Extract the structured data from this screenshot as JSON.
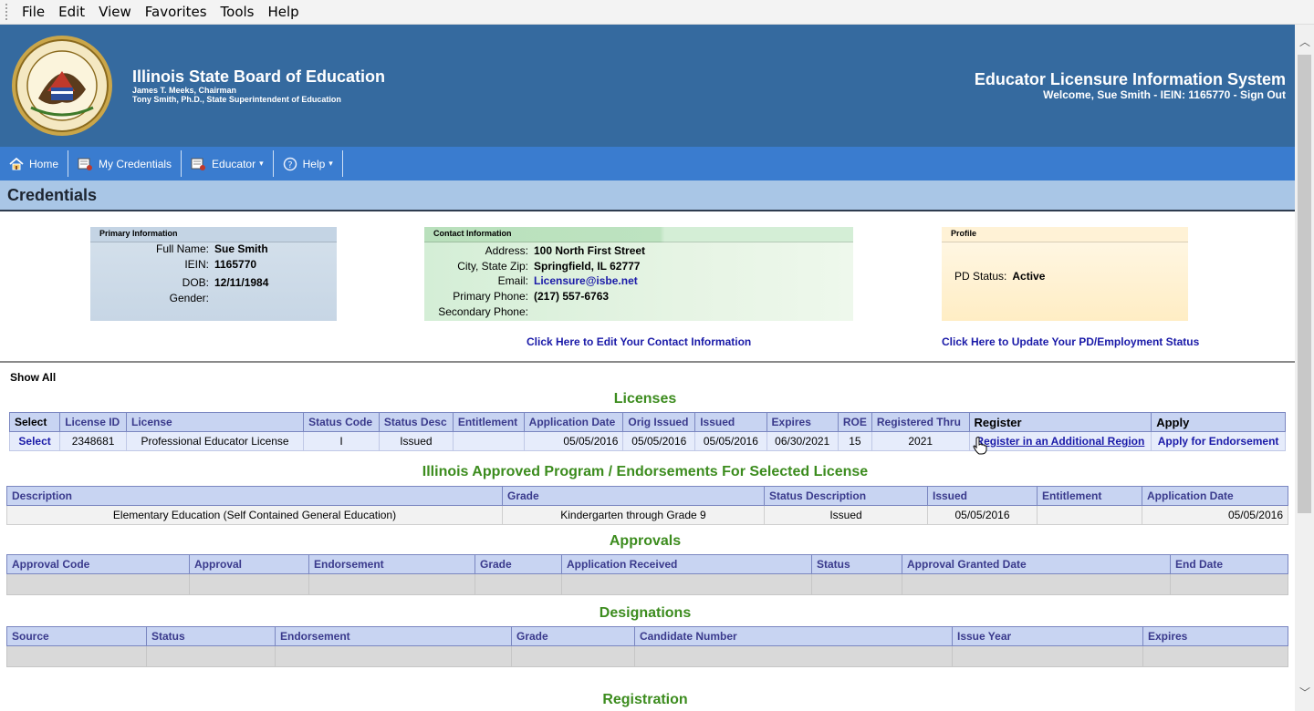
{
  "menu": [
    "File",
    "Edit",
    "View",
    "Favorites",
    "Tools",
    "Help"
  ],
  "header": {
    "org_title": "Illinois State Board of Education",
    "org_lines": [
      "James T. Meeks, Chairman",
      "Tony Smith, Ph.D., State Superintendent of Education"
    ],
    "system_title": "Educator Licensure Information System",
    "welcome": "Welcome, Sue Smith - IEIN: 1165770 - Sign Out"
  },
  "nav": [
    {
      "label": "Home",
      "icon": "home-icon"
    },
    {
      "label": "My Credentials",
      "icon": "credentials-icon"
    },
    {
      "label": "Educator",
      "icon": "educator-icon",
      "dropdown": true
    },
    {
      "label": "Help",
      "icon": "help-icon",
      "dropdown": true
    }
  ],
  "page_title": "Credentials",
  "primary": {
    "title": "Primary Information",
    "fields": [
      {
        "label": "Full Name:",
        "value": "Sue Smith"
      },
      {
        "label": "IEIN:",
        "value": "1165770"
      },
      {
        "label": "DOB:",
        "value": "12/11/1984"
      },
      {
        "label": "Gender:",
        "value": ""
      }
    ]
  },
  "contact": {
    "title": "Contact Information",
    "fields": [
      {
        "label": "Address:",
        "value": "100 North First Street"
      },
      {
        "label": "City, State Zip:",
        "value": "Springfield, IL 62777"
      },
      {
        "label": "Email:",
        "value": "Licensure@isbe.net"
      },
      {
        "label": "Primary Phone:",
        "value": "(217) 557-6763"
      },
      {
        "label": "Secondary Phone:",
        "value": ""
      }
    ],
    "link": "Click Here to Edit Your Contact Information"
  },
  "profile": {
    "title": "Profile",
    "pd_label": "PD Status:",
    "pd_value": "Active",
    "link": "Click Here to Update Your PD/Employment Status"
  },
  "show_all": "Show All",
  "licenses": {
    "title": "Licenses",
    "headers": [
      "Select",
      "License ID",
      "License",
      "Status Code",
      "Status Desc",
      "Entitlement",
      "Application Date",
      "Orig Issued",
      "Issued",
      "Expires",
      "ROE",
      "Registered Thru",
      "Register",
      "Apply"
    ],
    "row": [
      "Select",
      "2348681",
      "Professional Educator License",
      "I",
      "Issued",
      "",
      "05/05/2016",
      "05/05/2016",
      "05/05/2016",
      "06/30/2021",
      "15",
      "2021",
      "Register in an Additional Region",
      "Apply for Endorsement"
    ]
  },
  "endorsements": {
    "title": "Illinois Approved Program / Endorsements For Selected License",
    "headers": [
      "Description",
      "Grade",
      "Status Description",
      "Issued",
      "Entitlement",
      "Application Date"
    ],
    "row": [
      "Elementary Education (Self Contained General Education)",
      "Kindergarten through Grade 9",
      "Issued",
      "05/05/2016",
      "",
      "05/05/2016"
    ]
  },
  "approvals": {
    "title": "Approvals",
    "headers": [
      "Approval Code",
      "Approval",
      "Endorsement",
      "Grade",
      "Application Received",
      "Status",
      "Approval Granted Date",
      "End Date"
    ]
  },
  "designations": {
    "title": "Designations",
    "headers": [
      "Source",
      "Status",
      "Endorsement",
      "Grade",
      "Candidate Number",
      "Issue Year",
      "Expires"
    ]
  },
  "registration": {
    "title": "Registration"
  },
  "colors": {
    "header_bg": "#356a9f",
    "nav_bg": "#3a7ccf",
    "section_green": "#3c8c1e",
    "link_blue": "#1a1aa8"
  }
}
